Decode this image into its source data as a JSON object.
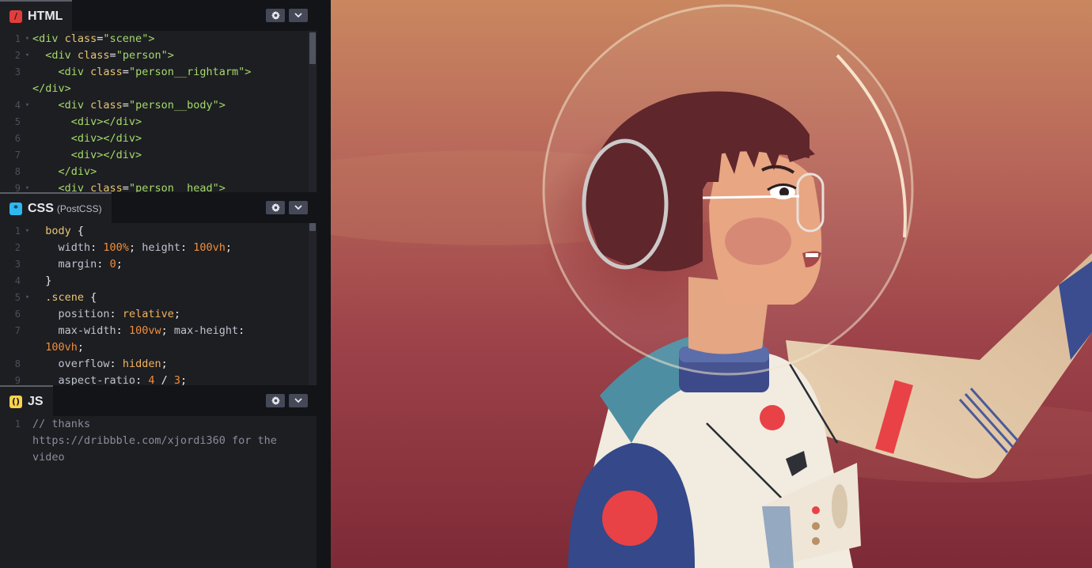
{
  "html_pane": {
    "title": "HTML",
    "lines": [
      {
        "n": "1",
        "fold": "▾",
        "tokens": [
          [
            "tag",
            "<div "
          ],
          [
            "attr",
            "class"
          ],
          [
            "plain",
            "="
          ],
          [
            "val",
            "\"scene\""
          ],
          [
            "tag",
            ">"
          ]
        ]
      },
      {
        "n": "2",
        "fold": "▾",
        "tokens": [
          [
            "plain",
            "  "
          ],
          [
            "tag",
            "<div "
          ],
          [
            "attr",
            "class"
          ],
          [
            "plain",
            "="
          ],
          [
            "val",
            "\"person\""
          ],
          [
            "tag",
            ">"
          ]
        ]
      },
      {
        "n": "3",
        "fold": "",
        "tokens": [
          [
            "plain",
            "    "
          ],
          [
            "tag",
            "<div "
          ],
          [
            "attr",
            "class"
          ],
          [
            "plain",
            "="
          ],
          [
            "val",
            "\"person__rightarm\""
          ],
          [
            "tag",
            ">"
          ]
        ]
      },
      {
        "n": "",
        "fold": "",
        "tokens": [
          [
            "tag",
            "</div>"
          ]
        ]
      },
      {
        "n": "4",
        "fold": "▾",
        "tokens": [
          [
            "plain",
            "    "
          ],
          [
            "tag",
            "<div "
          ],
          [
            "attr",
            "class"
          ],
          [
            "plain",
            "="
          ],
          [
            "val",
            "\"person__body\""
          ],
          [
            "tag",
            ">"
          ]
        ]
      },
      {
        "n": "5",
        "fold": "",
        "tokens": [
          [
            "plain",
            "      "
          ],
          [
            "tag",
            "<div></div>"
          ]
        ]
      },
      {
        "n": "6",
        "fold": "",
        "tokens": [
          [
            "plain",
            "      "
          ],
          [
            "tag",
            "<div></div>"
          ]
        ]
      },
      {
        "n": "7",
        "fold": "",
        "tokens": [
          [
            "plain",
            "      "
          ],
          [
            "tag",
            "<div></div>"
          ]
        ]
      },
      {
        "n": "8",
        "fold": "",
        "tokens": [
          [
            "plain",
            "    "
          ],
          [
            "tag",
            "</div>"
          ]
        ]
      },
      {
        "n": "9",
        "fold": "▾",
        "tokens": [
          [
            "plain",
            "    "
          ],
          [
            "tag",
            "<div "
          ],
          [
            "attr",
            "class"
          ],
          [
            "plain",
            "="
          ],
          [
            "val",
            "\"person__head\""
          ],
          [
            "tag",
            ">"
          ]
        ]
      }
    ]
  },
  "css_pane": {
    "title": "CSS",
    "subtitle": "(PostCSS)",
    "lines": [
      {
        "n": "1",
        "fold": "▾",
        "tokens": [
          [
            "plain",
            "  "
          ],
          [
            "sel",
            "body"
          ],
          [
            "plain",
            " {"
          ]
        ]
      },
      {
        "n": "2",
        "fold": "",
        "tokens": [
          [
            "plain",
            "    "
          ],
          [
            "prop",
            "width"
          ],
          [
            "plain",
            ": "
          ],
          [
            "num",
            "100%"
          ],
          [
            "plain",
            "; "
          ],
          [
            "prop",
            "height"
          ],
          [
            "plain",
            ": "
          ],
          [
            "num",
            "100vh"
          ],
          [
            "plain",
            ";"
          ]
        ]
      },
      {
        "n": "3",
        "fold": "",
        "tokens": [
          [
            "plain",
            "    "
          ],
          [
            "prop",
            "margin"
          ],
          [
            "plain",
            ": "
          ],
          [
            "num",
            "0"
          ],
          [
            "plain",
            ";"
          ]
        ]
      },
      {
        "n": "4",
        "fold": "",
        "tokens": [
          [
            "plain",
            "  }"
          ]
        ]
      },
      {
        "n": "5",
        "fold": "▾",
        "tokens": [
          [
            "plain",
            "  "
          ],
          [
            "sel",
            ".scene"
          ],
          [
            "plain",
            " {"
          ]
        ]
      },
      {
        "n": "6",
        "fold": "",
        "tokens": [
          [
            "plain",
            "    "
          ],
          [
            "prop",
            "position"
          ],
          [
            "plain",
            ": "
          ],
          [
            "kw",
            "relative"
          ],
          [
            "plain",
            ";"
          ]
        ]
      },
      {
        "n": "7",
        "fold": "",
        "tokens": [
          [
            "plain",
            "    "
          ],
          [
            "prop",
            "max-width"
          ],
          [
            "plain",
            ": "
          ],
          [
            "num",
            "100vw"
          ],
          [
            "plain",
            "; "
          ],
          [
            "prop",
            "max-height"
          ],
          [
            "plain",
            ":"
          ]
        ]
      },
      {
        "n": "",
        "fold": "",
        "tokens": [
          [
            "plain",
            "  "
          ],
          [
            "num",
            "100vh"
          ],
          [
            "plain",
            ";"
          ]
        ]
      },
      {
        "n": "8",
        "fold": "",
        "tokens": [
          [
            "plain",
            "    "
          ],
          [
            "prop",
            "overflow"
          ],
          [
            "plain",
            ": "
          ],
          [
            "kw",
            "hidden"
          ],
          [
            "plain",
            ";"
          ]
        ]
      },
      {
        "n": "9",
        "fold": "",
        "tokens": [
          [
            "plain",
            "    "
          ],
          [
            "prop",
            "aspect-ratio"
          ],
          [
            "plain",
            ": "
          ],
          [
            "num",
            "4"
          ],
          [
            "plain",
            " / "
          ],
          [
            "num",
            "3"
          ],
          [
            "plain",
            ";"
          ]
        ]
      }
    ]
  },
  "js_pane": {
    "title": "JS",
    "lines": [
      {
        "n": "1",
        "fold": "",
        "tokens": [
          [
            "cmt",
            "// thanks"
          ]
        ]
      },
      {
        "n": "",
        "fold": "",
        "tokens": [
          [
            "cmt",
            "https://dribbble.com/xjordi360 for the"
          ]
        ]
      },
      {
        "n": "",
        "fold": "",
        "tokens": [
          [
            "cmt",
            "video"
          ]
        ]
      }
    ]
  },
  "icons": {
    "html": "html-logo-icon",
    "css": "css-logo-icon",
    "js": "js-logo-icon",
    "settings": "gear-icon",
    "collapse": "chevron-down-icon"
  },
  "colors": {
    "editor_bg": "#1d1e22",
    "header_bg": "#131417",
    "preview_bg": "#9a4046",
    "suit": "#f2ece1",
    "suit_blue": "#36498a",
    "patch_red": "#e84246"
  }
}
